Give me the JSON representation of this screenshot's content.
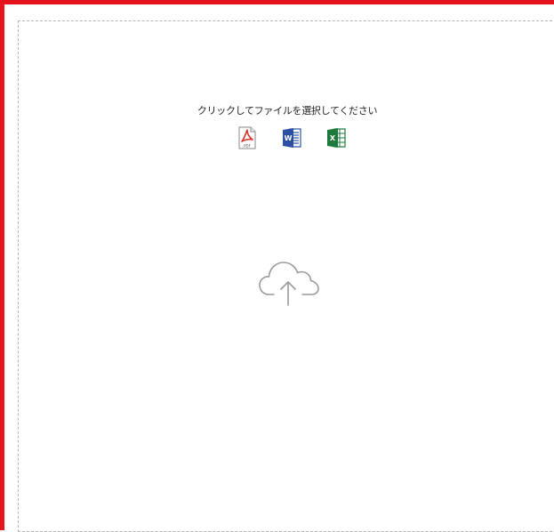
{
  "upload": {
    "prompt": "クリックしてファイルを選択してください",
    "accepted_types": [
      {
        "name": "pdf",
        "icon": "pdf-file-icon",
        "label": "PDF",
        "color": "#d9342b"
      },
      {
        "name": "word",
        "icon": "word-file-icon",
        "label": "W",
        "color": "#2b4fa3"
      },
      {
        "name": "excel",
        "icon": "excel-file-icon",
        "label": "X",
        "color": "#1e7a3c"
      }
    ],
    "upload_icon": "cloud-upload-icon"
  },
  "colors": {
    "accent_border": "#e5141c",
    "dashed_border": "#b5b5b5",
    "icon_gray": "#9a9a9a"
  }
}
